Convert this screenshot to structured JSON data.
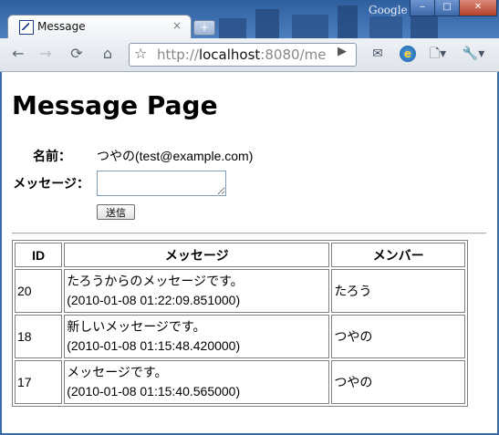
{
  "window": {
    "brand": "Google",
    "minimize": "‒",
    "maximize": "□",
    "close": "✕"
  },
  "tab": {
    "title": "Message",
    "favicon": "page-favicon-icon",
    "close": "×",
    "new_tab": "+"
  },
  "toolbar": {
    "back": "←",
    "forward": "→",
    "reload": "⟳",
    "home": "⌂",
    "star": "☆",
    "url_scheme": "http://",
    "url_host": "localhost",
    "url_rest": ":8080/me",
    "go": "▶",
    "mail": "✉",
    "ie": "e",
    "page_menu": "🗋▾",
    "wrench_menu": "🔧▾"
  },
  "page": {
    "title": "Message Page",
    "name_label": "名前：",
    "name_value": "つやの(test@example.com)",
    "message_label": "メッセージ：",
    "message_value": "",
    "send_label": "送信",
    "table": {
      "headers": [
        "ID",
        "メッセージ",
        "メンバー"
      ],
      "rows": [
        {
          "id": "20",
          "message": "たろうからのメッセージです。",
          "timestamp": "(2010-01-08 01:22:09.851000)",
          "member": "たろう"
        },
        {
          "id": "18",
          "message": "新しいメッセージです。",
          "timestamp": "(2010-01-08 01:15:48.420000)",
          "member": "つやの"
        },
        {
          "id": "17",
          "message": "メッセージです。",
          "timestamp": "(2010-01-08 01:15:40.565000)",
          "member": "つやの"
        }
      ]
    }
  }
}
